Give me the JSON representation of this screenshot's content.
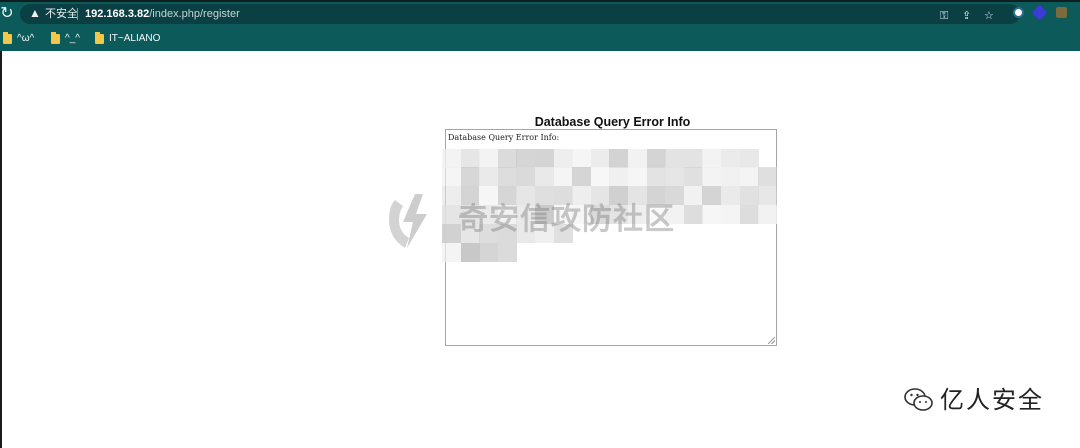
{
  "browser": {
    "security_label": "不安全",
    "url_host": "192.168.3.82",
    "url_path": "/index.php/register",
    "icons": [
      "reload-icon",
      "warning-icon",
      "key-icon",
      "share-icon",
      "star-icon",
      "extension-icons"
    ],
    "colors": {
      "toolbar": "#0c5a5a",
      "omnibox": "#0a3f44"
    }
  },
  "bookmarks": [
    {
      "label": "^ω^"
    },
    {
      "label": "^_^"
    },
    {
      "label": "IT~ALIANO"
    }
  ],
  "page": {
    "heading": "Database Query Error Info",
    "error_text": "Database Query Error Info:"
  },
  "watermark": {
    "text": "奇安信攻防社区"
  },
  "brand": {
    "name": "亿人安全"
  }
}
